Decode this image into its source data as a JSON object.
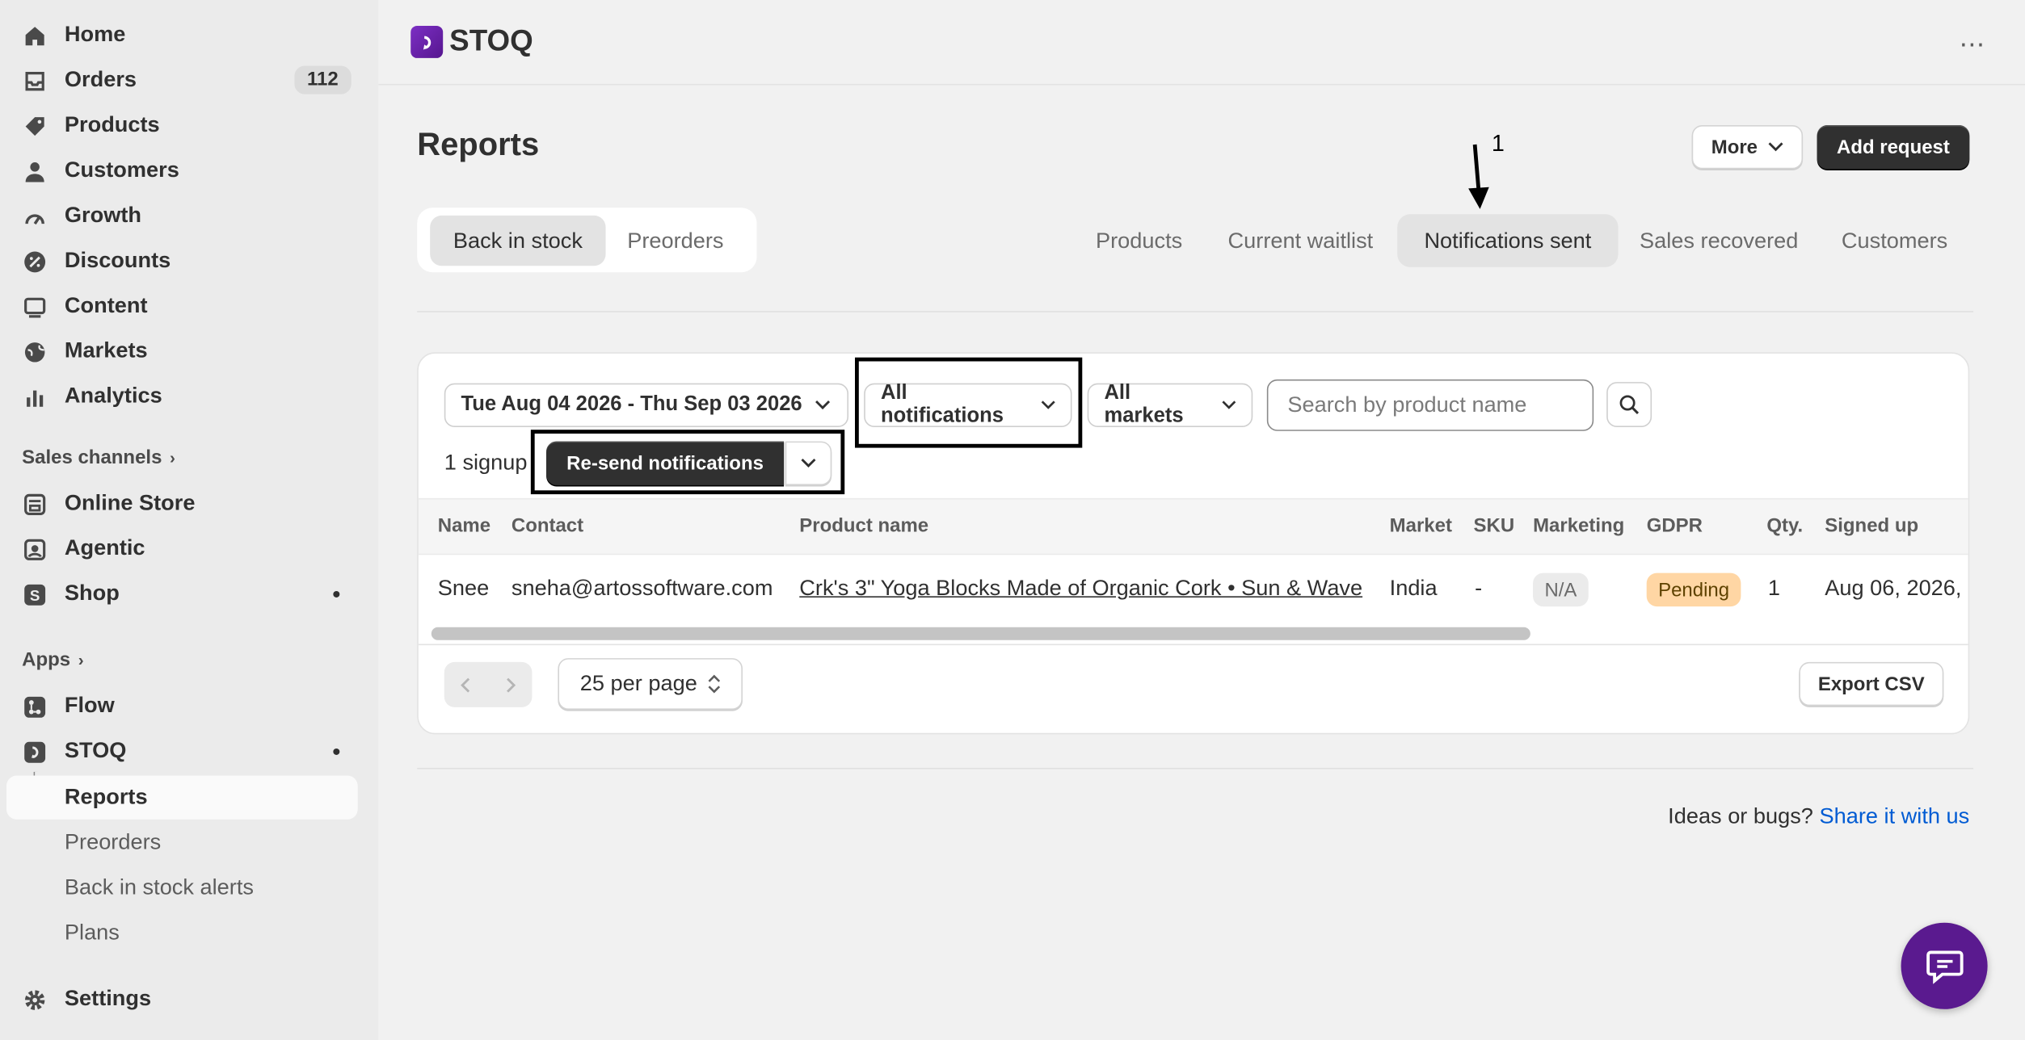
{
  "sidebar": {
    "items": [
      {
        "label": "Home",
        "icon": "home-icon"
      },
      {
        "label": "Orders",
        "icon": "inbox-icon",
        "badge": "112"
      },
      {
        "label": "Products",
        "icon": "tag-icon"
      },
      {
        "label": "Customers",
        "icon": "person-icon"
      },
      {
        "label": "Growth",
        "icon": "gauge-icon"
      },
      {
        "label": "Discounts",
        "icon": "discount-icon"
      },
      {
        "label": "Content",
        "icon": "image-icon"
      },
      {
        "label": "Markets",
        "icon": "globe-icon"
      },
      {
        "label": "Analytics",
        "icon": "bar-chart-icon"
      }
    ],
    "sales_channels_heading": "Sales channels",
    "channels": [
      {
        "label": "Online Store",
        "icon": "store-icon"
      },
      {
        "label": "Agentic",
        "icon": "agentic-icon"
      },
      {
        "label": "Shop",
        "icon": "shop-icon"
      }
    ],
    "apps_heading": "Apps",
    "apps": [
      {
        "label": "Flow",
        "icon": "flow-icon"
      },
      {
        "label": "STOQ",
        "icon": "stoq-icon"
      }
    ],
    "stoq_subitems": [
      "Reports",
      "Preorders",
      "Back in stock alerts",
      "Plans"
    ],
    "settings_label": "Settings"
  },
  "topbar": {
    "app_name": "STOQ",
    "menu_glyph": "⋯"
  },
  "page": {
    "title": "Reports",
    "more_label": "More",
    "add_request_label": "Add request",
    "annotation_number": "1"
  },
  "segments": [
    "Back in stock",
    "Preorders"
  ],
  "tabs": [
    "Products",
    "Current waitlist",
    "Notifications sent",
    "Sales recovered",
    "Customers"
  ],
  "filters": {
    "date_range": "Tue Aug 04 2026 - Thu Sep 03 2026",
    "notifications": "All notifications",
    "markets": "All markets",
    "search_placeholder": "Search by product name"
  },
  "bulk": {
    "count_text": "1 signup",
    "resend_label": "Re-send notifications"
  },
  "table": {
    "headers": [
      "Name",
      "Contact",
      "Product name",
      "Market",
      "SKU",
      "Marketing",
      "GDPR",
      "Qty.",
      "Signed up"
    ],
    "rows": [
      {
        "name": "Snee",
        "contact": "sneha@artossoftware.com",
        "product": "Crk's 3\" Yoga Blocks Made of Organic Cork • Sun & Wave",
        "market": "India",
        "sku": "-",
        "marketing": "N/A",
        "gdpr": "Pending",
        "qty": "1",
        "signed_up": "Aug 06, 2026,"
      }
    ]
  },
  "pagination": {
    "per_page": "25 per page",
    "export_label": "Export CSV"
  },
  "footer": {
    "text": "Ideas or bugs? ",
    "link": "Share it with us"
  },
  "colors": {
    "brand": "#5a1a8f",
    "dark_button": "#303030",
    "link": "#005bd3",
    "pending_badge": "#ffd6a4"
  }
}
